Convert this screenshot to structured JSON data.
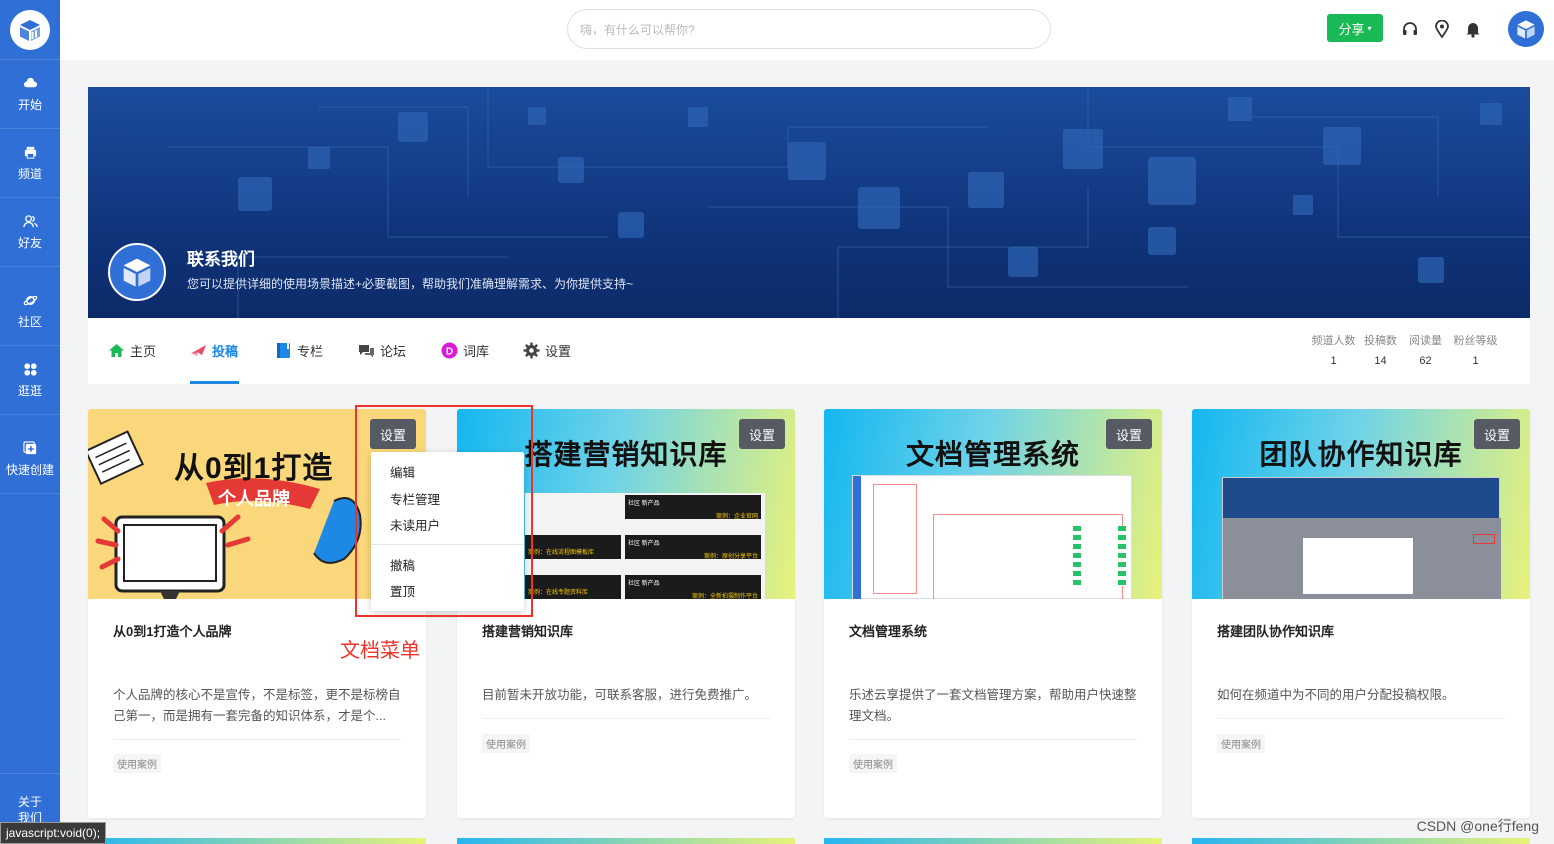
{
  "sidebar": {
    "items": [
      {
        "label": "开始",
        "icon": "cloud-icon"
      },
      {
        "label": "频道",
        "icon": "printer-icon"
      },
      {
        "label": "好友",
        "icon": "users-icon"
      },
      {
        "label": "社区",
        "icon": "planet-icon"
      },
      {
        "label": "逛逛",
        "icon": "grid-icon"
      },
      {
        "label": "快速创建",
        "icon": "plus-square-icon"
      }
    ],
    "about_label": "关于我们",
    "status_url": "javascript:void(0);"
  },
  "header": {
    "search_placeholder": "嗨，有什么可以帮你?",
    "share_label": "分享"
  },
  "banner": {
    "title": "联系我们",
    "description": "您可以提供详细的使用场景描述+必要截图，帮助我们准确理解需求、为你提供支持~"
  },
  "tabs": [
    {
      "label": "主页",
      "icon": "home-icon",
      "color": "#19b955"
    },
    {
      "label": "投稿",
      "icon": "plane-icon",
      "color": "#e94b6b",
      "active": true
    },
    {
      "label": "专栏",
      "icon": "book-icon",
      "color": "#1e88e5"
    },
    {
      "label": "论坛",
      "icon": "chat-icon",
      "color": "#444444"
    },
    {
      "label": "词库",
      "icon": "d-badge-icon",
      "color": "#d81bd6"
    },
    {
      "label": "设置",
      "icon": "gear-icon",
      "color": "#444444"
    }
  ],
  "stats": [
    {
      "label": "频道人数",
      "value": "1"
    },
    {
      "label": "投稿数",
      "value": "14"
    },
    {
      "label": "阅读量",
      "value": "62"
    },
    {
      "label": "粉丝等级",
      "value": "1"
    }
  ],
  "cards": [
    {
      "title": "从0到1打造个人品牌",
      "cover_title": "从0到1打造",
      "cover_subtitle": "个人品牌",
      "desc": "个人品牌的核心不是宣传，不是标签，更不是标榜自己第一，而是拥有一套完备的知识体系，才是个...",
      "tag": "使用案例",
      "settings_label": "设置"
    },
    {
      "title": "搭建营销知识库",
      "cover_title": "搭建营销知识库",
      "desc": "目前暂未开放功能，可联系客服，进行免费推广。",
      "tag": "使用案例",
      "settings_label": "设置"
    },
    {
      "title": "文档管理系统",
      "cover_title": "文档管理系统",
      "desc": "乐述云享提供了一套文档管理方案，帮助用户快速整理文档。",
      "tag": "使用案例",
      "settings_label": "设置"
    },
    {
      "title": "搭建团队协作知识库",
      "cover_title": "团队协作知识库",
      "desc": "如何在频道中为不同的用户分配投稿权限。",
      "tag": "使用案例",
      "settings_label": "设置"
    }
  ],
  "marketing_tiles": [
    "社区 新产品",
    "案例：企业官网",
    "案例：在线流程图模板库",
    "社区 新产品",
    "案例：原创分享平台",
    "社区 新产品",
    "案例：在线专题资料库",
    "案例：全新拍摄制作平台"
  ],
  "popup_menu": {
    "items_top": [
      "编辑",
      "专栏管理",
      "未读用户"
    ],
    "items_bottom": [
      "撤稿",
      "置顶"
    ]
  },
  "annotation": "文档菜单",
  "watermark": "CSDN @one行feng",
  "colors": {
    "sidebar": "#2f6fd6",
    "accent": "#1e88e5",
    "share": "#19b955",
    "highlight": "#f0322d"
  }
}
